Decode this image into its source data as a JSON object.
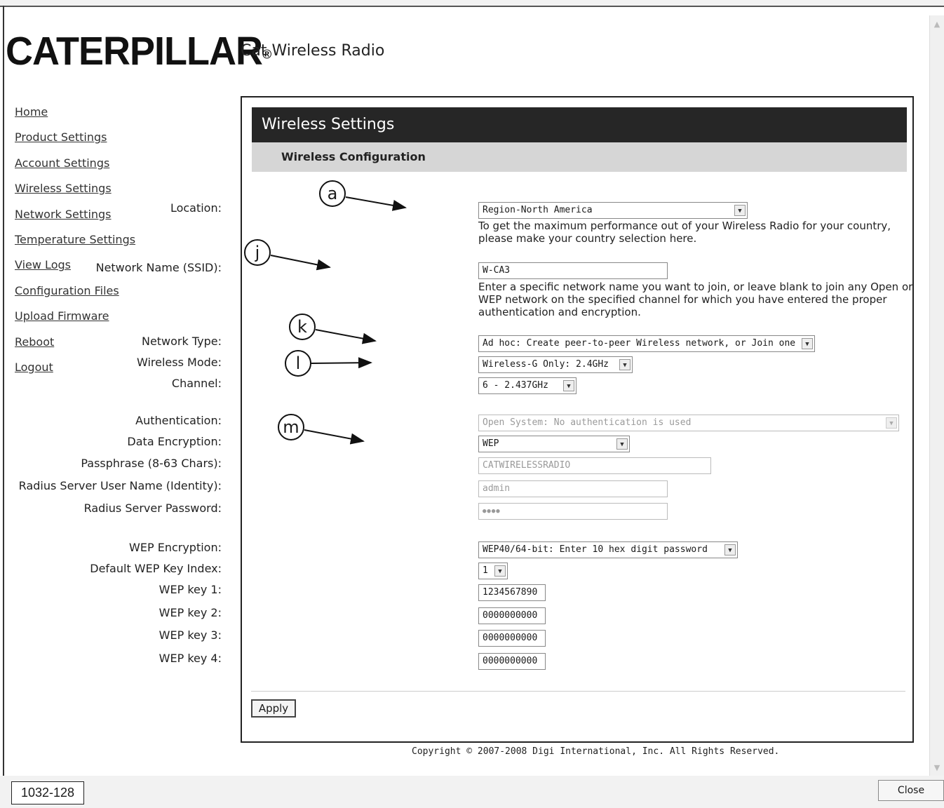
{
  "app": {
    "brand": "CATERPILLAR",
    "brand_mark": "®",
    "title": "Cat Wireless Radio"
  },
  "sidebar": {
    "items": [
      {
        "label": "Home"
      },
      {
        "label": "Product Settings"
      },
      {
        "label": "Account Settings"
      },
      {
        "label": "Wireless Settings"
      },
      {
        "label": "Network Settings"
      },
      {
        "label": "Temperature Settings"
      },
      {
        "label": "View Logs"
      },
      {
        "label": "Configuration Files"
      },
      {
        "label": "Upload Firmware"
      },
      {
        "label": "Reboot"
      },
      {
        "label": "Logout"
      }
    ]
  },
  "panel": {
    "title": "Wireless Settings",
    "subtitle": "Wireless Configuration"
  },
  "form": {
    "location": {
      "label": "Location:",
      "value": "Region-North America",
      "help": "To get the maximum performance out of your Wireless Radio for your country, please make your country selection here."
    },
    "ssid": {
      "label": "Network Name (SSID):",
      "value": "W-CA3",
      "help": "Enter a specific network name you want to join, or leave blank to join any Open or WEP network on the specified channel for which you have entered the proper authentication and encryption."
    },
    "network_type": {
      "label": "Network Type:",
      "value": "Ad hoc: Create peer-to-peer Wireless network, or Join one"
    },
    "wireless_mode": {
      "label": "Wireless Mode:",
      "value": "Wireless-G Only: 2.4GHz"
    },
    "channel": {
      "label": "Channel:",
      "value": "6 - 2.437GHz"
    },
    "authentication": {
      "label": "Authentication:",
      "value": "Open System: No authentication is used"
    },
    "data_encryption": {
      "label": "Data Encryption:",
      "value": "WEP"
    },
    "passphrase": {
      "label": "Passphrase (8-63 Chars):",
      "value": "CATWIRELESSRADIO"
    },
    "radius_user": {
      "label": "Radius Server User Name (Identity):",
      "value": "admin"
    },
    "radius_password": {
      "label": "Radius Server Password:",
      "value": "●●●●"
    },
    "wep_encryption": {
      "label": "WEP Encryption:",
      "value": "WEP40/64-bit: Enter 10 hex digit password"
    },
    "wep_key_index": {
      "label": "Default WEP Key Index:",
      "value": "1"
    },
    "wep_key1": {
      "label": "WEP key 1:",
      "value": "1234567890"
    },
    "wep_key2": {
      "label": "WEP key 2:",
      "value": "0000000000"
    },
    "wep_key3": {
      "label": "WEP key 3:",
      "value": "0000000000"
    },
    "wep_key4": {
      "label": "WEP key 4:",
      "value": "0000000000"
    }
  },
  "callouts": {
    "a": "a",
    "j": "j",
    "k": "k",
    "l": "l",
    "m": "m"
  },
  "buttons": {
    "apply": "Apply",
    "close": "Close"
  },
  "footer": {
    "copyright": "Copyright © 2007-2008 Digi International, Inc. All Rights Reserved."
  },
  "figure_label": "1032-128",
  "icons": {
    "select_arrow": "chevron-down-icon",
    "scroll_up": "scroll-up-icon",
    "scroll_down": "scroll-down-icon"
  }
}
